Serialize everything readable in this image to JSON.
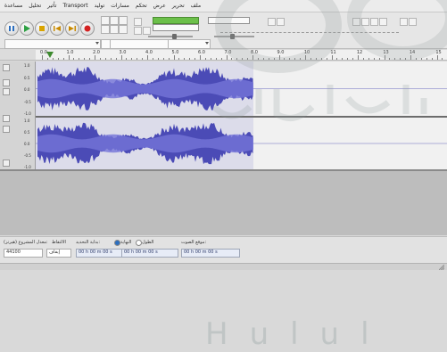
{
  "menu": {
    "items": [
      "ملف",
      "تحرير",
      "عرض",
      "تحكم",
      "مسارات",
      "توليد",
      "Transport",
      "تأثير",
      "تحليل",
      "مساعدة"
    ]
  },
  "toolbar": {
    "buttons": [
      "pause-icon",
      "play-icon",
      "stop-icon",
      "skip-start-icon",
      "skip-end-icon",
      "record-icon"
    ],
    "device_select_1": "",
    "device_select_2": ""
  },
  "ruler": {
    "labels": [
      "0.0",
      "1.0",
      "2.0",
      "3.0",
      "4.0",
      "5.0",
      "6.0",
      "7.0",
      "8.0",
      "9.0",
      "10",
      "11",
      "12",
      "13",
      "14",
      "15"
    ]
  },
  "track": {
    "scale": [
      "1.0",
      "0.5",
      "0.0",
      "-0.5",
      "-1.0"
    ],
    "waveform_color": "#4b4bb6",
    "clip_end_fraction": 0.53
  },
  "selection_bar": {
    "rate_label": "معدل المشروع (هيرتز):",
    "rate_value": "44100",
    "snap_label": "الالتقاط",
    "snap_value": "إيقاف",
    "start_label": "بداية التحديد:",
    "end_label": "النهاية",
    "length_label": "الطول",
    "position_label": "موقع الصوت:",
    "start_value": "00 h 00 m 00 s",
    "end_value": "00 h 00 m 00 s",
    "position_value": "00 h 00 m 00 s"
  },
  "watermark": {
    "latin": "Hulul"
  }
}
